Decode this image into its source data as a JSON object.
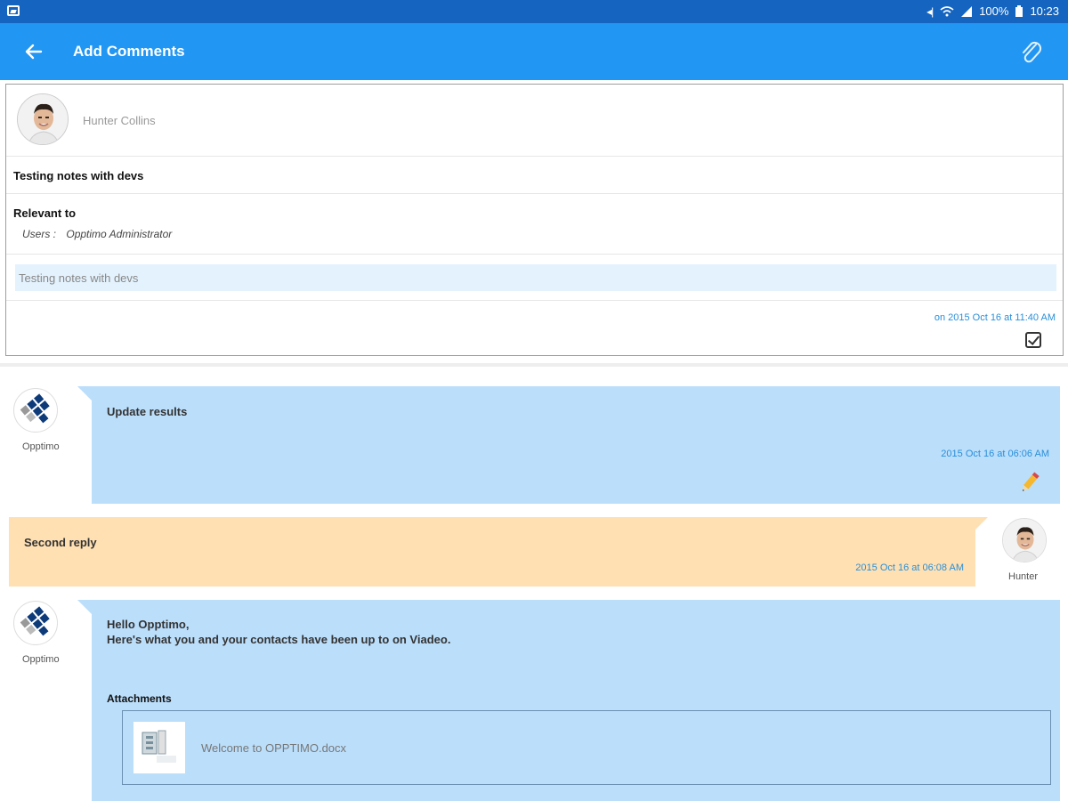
{
  "status_bar": {
    "battery": "100%",
    "time": "10:23"
  },
  "app_bar": {
    "title": "Add Comments"
  },
  "note": {
    "author": "Hunter Collins",
    "subject": "Testing notes with devs",
    "relevant_title": "Relevant to",
    "users_label": "Users :",
    "users_value": "Opptimo Administrator",
    "body": "Testing notes with devs",
    "timestamp": "on 2015 Oct 16 at 11:40 AM"
  },
  "comments": [
    {
      "author": "Opptimo",
      "text": "Update results",
      "timestamp": "2015 Oct 16 at 06:06 AM",
      "color": "#bbdefb"
    },
    {
      "author": "Hunter",
      "text": "Second reply",
      "timestamp": "2015 Oct 16 at 06:08 AM",
      "color": "#ffe0b2"
    },
    {
      "author": "Opptimo",
      "text_line1": "Hello Opptimo,",
      "text_line2": "Here's what you and your contacts have been up to on Viadeo.",
      "attachments_title": "Attachments",
      "attachment_name": "Welcome to OPPTIMO.docx",
      "color": "#bbdefb"
    }
  ],
  "colors": {
    "status_bar": "#1565c0",
    "app_bar": "#2196f3",
    "accent_text": "#2a8fd8"
  }
}
